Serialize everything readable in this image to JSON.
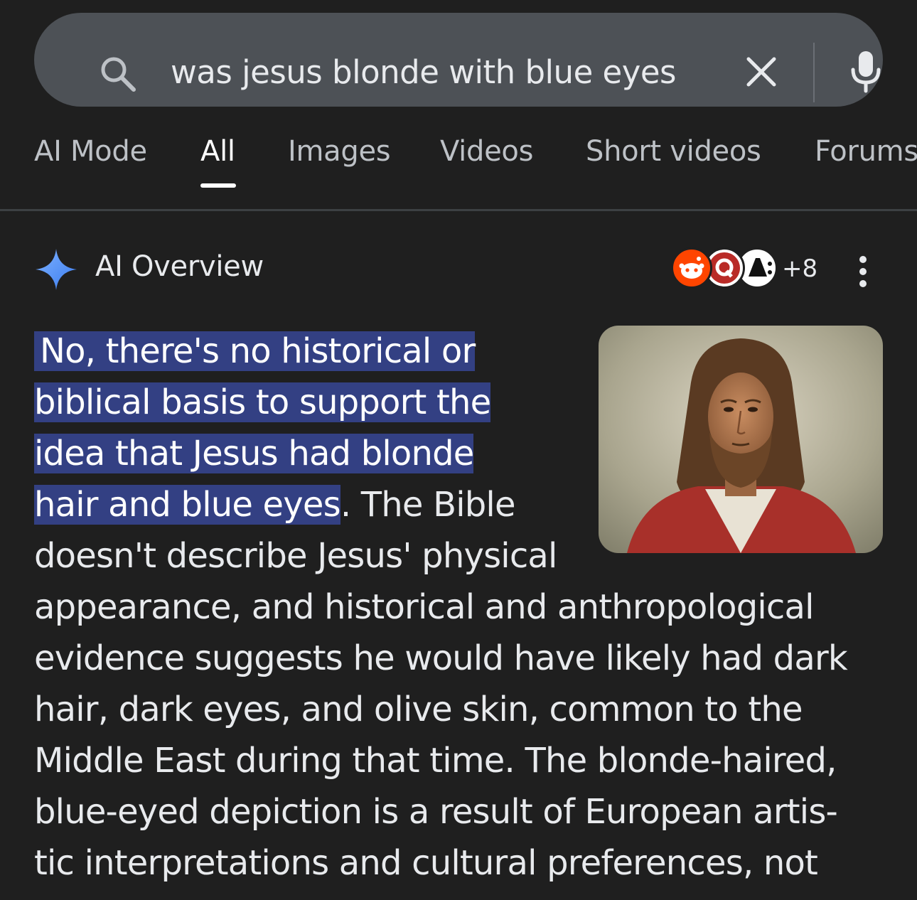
{
  "search": {
    "query": "was jesus blonde with blue eyes",
    "icons": [
      "search-icon",
      "clear-icon",
      "microphone-icon"
    ]
  },
  "tabs": [
    {
      "label": "AI Mode",
      "active": false
    },
    {
      "label": "All",
      "active": true
    },
    {
      "label": "Images",
      "active": false
    },
    {
      "label": "Videos",
      "active": false
    },
    {
      "label": "Short videos",
      "active": false
    },
    {
      "label": "Forums",
      "active": false
    }
  ],
  "ai_overview": {
    "title": "AI Overview",
    "sources_more": "+8",
    "sources": [
      "reddit-icon",
      "quora-icon",
      "source-icon"
    ],
    "image_subject": "painting of Jesus with long hair and beard in red robe",
    "highlight_lines": [
      "No, there's no historical or",
      "biblical basis to support the",
      "idea that Jesus had blonde",
      "hair and blue eyes"
    ],
    "line4_rest": ". The Bible",
    "lines": [
      "doesn't describe Jesus' physical",
      "appearance, and historical and anthropological",
      "evidence suggests he would have likely had dark",
      "hair, dark eyes, and olive skin, common to the",
      "Middle East during that time. The blonde-haired,",
      "blue-eyed depiction is a result of European artis-",
      "tic interpretations and cultural preferences, not"
    ]
  },
  "colors": {
    "background": "#1f1f1f",
    "search_bar": "#4d5156",
    "highlight": "#334083",
    "sparkle": "#4f8df7"
  }
}
